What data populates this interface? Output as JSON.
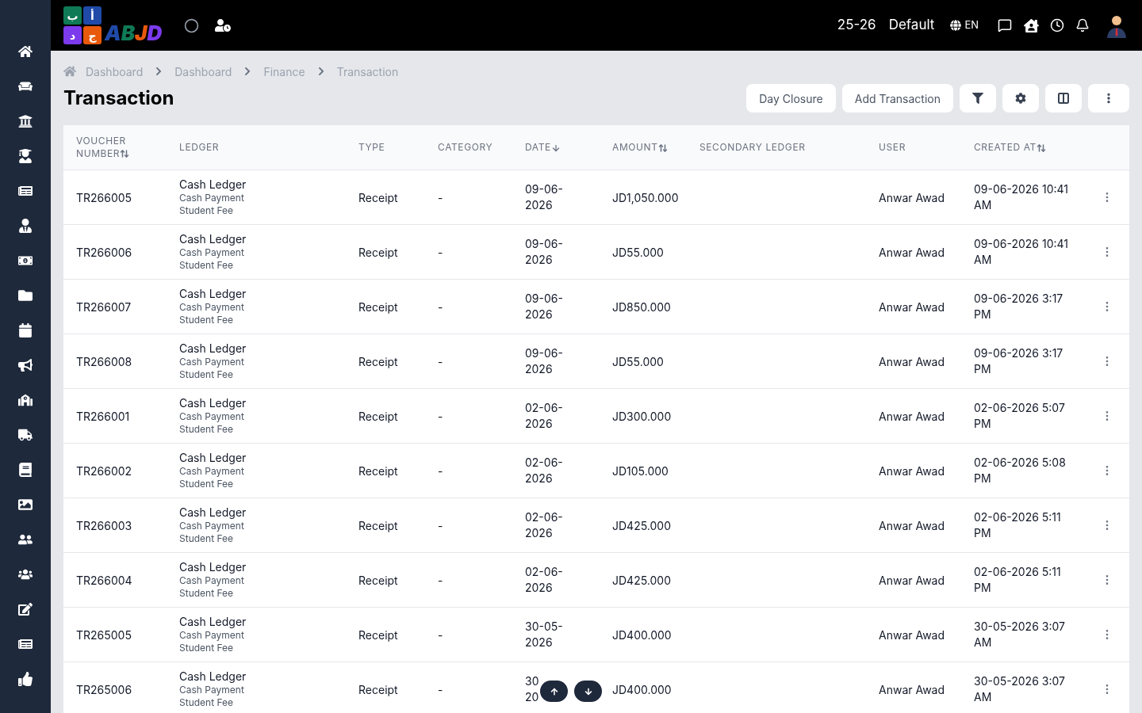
{
  "header": {
    "logo": {
      "tile_rows": [
        {
          "tiles": [
            {
              "char": "أ",
              "color": "#1f4aa8"
            },
            {
              "char": "ب",
              "color": "#0f7a55"
            }
          ]
        },
        {
          "tiles": [
            {
              "char": "ج",
              "color": "#e8590c"
            },
            {
              "char": "د",
              "color": "#7c3aed"
            }
          ]
        }
      ],
      "letters": [
        {
          "char": "A",
          "color": "#1f4aa8"
        },
        {
          "char": "B",
          "color": "#0f7a55"
        },
        {
          "char": "J",
          "color": "#e8590c"
        },
        {
          "char": "D",
          "color": "#7c3aed"
        }
      ]
    },
    "year": "25-26",
    "profile": "Default",
    "language": "EN"
  },
  "breadcrumb": [
    "Dashboard",
    "Dashboard",
    "Finance",
    "Transaction"
  ],
  "title": "Transaction",
  "actions": [
    "Day Closure",
    "Add Transaction"
  ],
  "table": {
    "columns": [
      {
        "label": "VOUCHER NUMBER",
        "sortable": true,
        "descending": false
      },
      {
        "label": "LEDGER",
        "sortable": false
      },
      {
        "label": "TYPE",
        "sortable": false
      },
      {
        "label": "CATEGORY",
        "sortable": false
      },
      {
        "label": "DATE",
        "sortable": true,
        "descending": true
      },
      {
        "label": "AMOUNT",
        "sortable": true,
        "descending": false
      },
      {
        "label": "SECONDARY LEDGER",
        "sortable": false
      },
      {
        "label": "USER",
        "sortable": false
      },
      {
        "label": "CREATED AT",
        "sortable": true,
        "descending": false
      }
    ],
    "rows": [
      {
        "voucher": "TR266005",
        "ledger": "Cash Ledger",
        "sub1": "Cash Payment",
        "sub2": "Student Fee",
        "type": "Receipt",
        "category": "-",
        "date": "09-06-2026",
        "amount": "JD1,050.000",
        "user": "Anwar Awad",
        "created": "09-06-2026 10:41 AM"
      },
      {
        "voucher": "TR266006",
        "ledger": "Cash Ledger",
        "sub1": "Cash Payment",
        "sub2": "Student Fee",
        "type": "Receipt",
        "category": "-",
        "date": "09-06-2026",
        "amount": "JD55.000",
        "user": "Anwar Awad",
        "created": "09-06-2026 10:41 AM"
      },
      {
        "voucher": "TR266007",
        "ledger": "Cash Ledger",
        "sub1": "Cash Payment",
        "sub2": "Student Fee",
        "type": "Receipt",
        "category": "-",
        "date": "09-06-2026",
        "amount": "JD850.000",
        "user": "Anwar Awad",
        "created": "09-06-2026 3:17 PM"
      },
      {
        "voucher": "TR266008",
        "ledger": "Cash Ledger",
        "sub1": "Cash Payment",
        "sub2": "Student Fee",
        "type": "Receipt",
        "category": "-",
        "date": "09-06-2026",
        "amount": "JD55.000",
        "user": "Anwar Awad",
        "created": "09-06-2026 3:17 PM"
      },
      {
        "voucher": "TR266001",
        "ledger": "Cash Ledger",
        "sub1": "Cash Payment",
        "sub2": "Student Fee",
        "type": "Receipt",
        "category": "-",
        "date": "02-06-2026",
        "amount": "JD300.000",
        "user": "Anwar Awad",
        "created": "02-06-2026 5:07 PM"
      },
      {
        "voucher": "TR266002",
        "ledger": "Cash Ledger",
        "sub1": "Cash Payment",
        "sub2": "Student Fee",
        "type": "Receipt",
        "category": "-",
        "date": "02-06-2026",
        "amount": "JD105.000",
        "user": "Anwar Awad",
        "created": "02-06-2026 5:08 PM"
      },
      {
        "voucher": "TR266003",
        "ledger": "Cash Ledger",
        "sub1": "Cash Payment",
        "sub2": "Student Fee",
        "type": "Receipt",
        "category": "-",
        "date": "02-06-2026",
        "amount": "JD425.000",
        "user": "Anwar Awad",
        "created": "02-06-2026 5:11 PM"
      },
      {
        "voucher": "TR266004",
        "ledger": "Cash Ledger",
        "sub1": "Cash Payment",
        "sub2": "Student Fee",
        "type": "Receipt",
        "category": "-",
        "date": "02-06-2026",
        "amount": "JD425.000",
        "user": "Anwar Awad",
        "created": "02-06-2026 5:11 PM"
      },
      {
        "voucher": "TR265005",
        "ledger": "Cash Ledger",
        "sub1": "Cash Payment",
        "sub2": "Student Fee",
        "type": "Receipt",
        "category": "-",
        "date": "30-05-2026",
        "amount": "JD400.000",
        "user": "Anwar Awad",
        "created": "30-05-2026 3:07 AM"
      },
      {
        "voucher": "TR265006",
        "ledger": "Cash Ledger",
        "sub1": "Cash Payment",
        "sub2": "Student Fee",
        "type": "Receipt",
        "category": "-",
        "date": "30\n20",
        "amount": "JD400.000",
        "user": "Anwar Awad",
        "created": "30-05-2026 3:07 AM"
      }
    ]
  }
}
